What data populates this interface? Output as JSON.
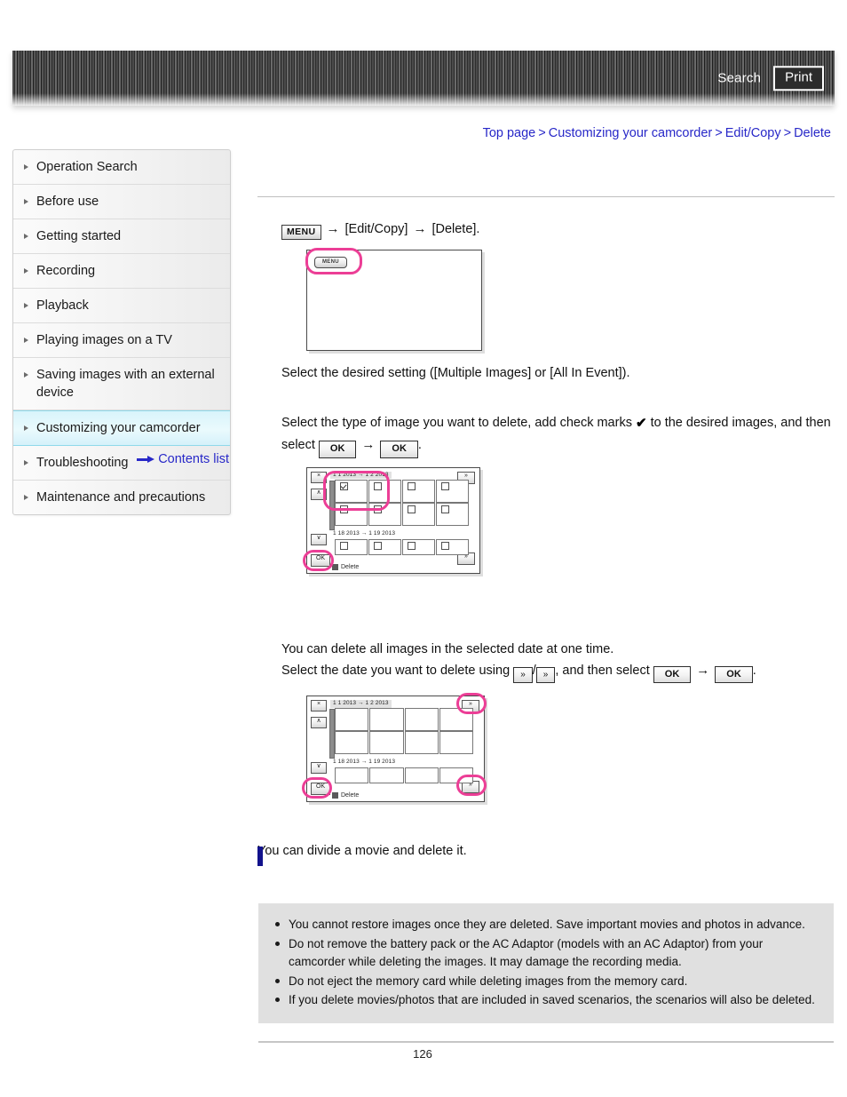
{
  "header": {
    "search_label": "Search",
    "print_label": "Print",
    "search_icon": "search-icon",
    "print_icon": "print-icon"
  },
  "breadcrumb": {
    "separator": ">",
    "items": [
      {
        "label": "Top page"
      },
      {
        "label": "Customizing your camcorder"
      },
      {
        "label": "Edit/Copy"
      },
      {
        "label": "Delete"
      }
    ]
  },
  "sidebar": {
    "items": [
      {
        "label": "Operation Search",
        "active": false
      },
      {
        "label": "Before use",
        "active": false
      },
      {
        "label": "Getting started",
        "active": false
      },
      {
        "label": "Recording",
        "active": false
      },
      {
        "label": "Playback",
        "active": false
      },
      {
        "label": "Playing images on a TV",
        "active": false
      },
      {
        "label": "Saving images with an external device",
        "active": false
      },
      {
        "label": "Customizing your camcorder",
        "active": true
      },
      {
        "label": "Troubleshooting",
        "active": false
      },
      {
        "label": "Maintenance and precautions",
        "active": false
      }
    ],
    "contents_list_label": "Contents list"
  },
  "main": {
    "step1": {
      "menu_button_label": "MENU",
      "arrow": "→",
      "part2": "[Edit/Copy]",
      "part3": "[Delete]."
    },
    "step2": {
      "text": "Select the desired setting ([Multiple Images] or [All In Event])."
    },
    "step3": {
      "line1_a": "Select the type of image you want to delete, add check marks",
      "check_glyph": "✔",
      "line1_b": "to the desired images, and then",
      "line2_a": "select",
      "ok_label": "OK",
      "arrow": "→",
      "period": "."
    },
    "step4": {
      "line1": "You can delete all images in the selected date at one time.",
      "line2_a": "Select the date you want to delete using",
      "chev_up": "»",
      "slash": "/",
      "chev_down": "»",
      "line2_b": ", and then select",
      "ok_label": "OK",
      "arrow": "→",
      "period": "."
    },
    "step5": {
      "text": "You can divide a movie and delete it."
    }
  },
  "illustrations": {
    "menu_screen": {
      "menu_chip_label": "MENU"
    },
    "grid_screen_1": {
      "close_label": "×",
      "scroll_up_label": "∧",
      "scroll_down_label": "∨",
      "ok_label": "OK",
      "date_top_label": "1 1 2013 → 1 2 2013",
      "date_bottom_label": "1 18 2013 → 1 19 2013",
      "delete_label": "Delete",
      "page_up_label": "»",
      "page_down_label": "»"
    },
    "grid_screen_2": {
      "close_label": "×",
      "scroll_up_label": "∧",
      "scroll_down_label": "∨",
      "ok_label": "OK",
      "date_top_label": "1 1 2013 → 1 2 2013",
      "date_bottom_label": "1 18 2013 → 1 19 2013",
      "delete_label": "Delete",
      "page_up_label": "»",
      "page_down_label": "»"
    }
  },
  "notes": {
    "items": [
      "You cannot restore images once they are deleted. Save important movies and photos in advance.",
      "Do not remove the battery pack or the AC Adaptor (models with an AC Adaptor) from your camcorder while deleting the images. It may damage the recording media.",
      "Do not eject the memory card while deleting images from the memory card.",
      "If you delete movies/photos that are included in saved scenarios, the scenarios will also be deleted."
    ]
  },
  "footer": {
    "page_number": "126"
  },
  "colors": {
    "link": "#2828c8",
    "highlight_ring": "#ec3e96",
    "sidebar_active": "#d9f4fb",
    "section_mark": "#12128c",
    "notes_bg": "#e0e0e0"
  }
}
